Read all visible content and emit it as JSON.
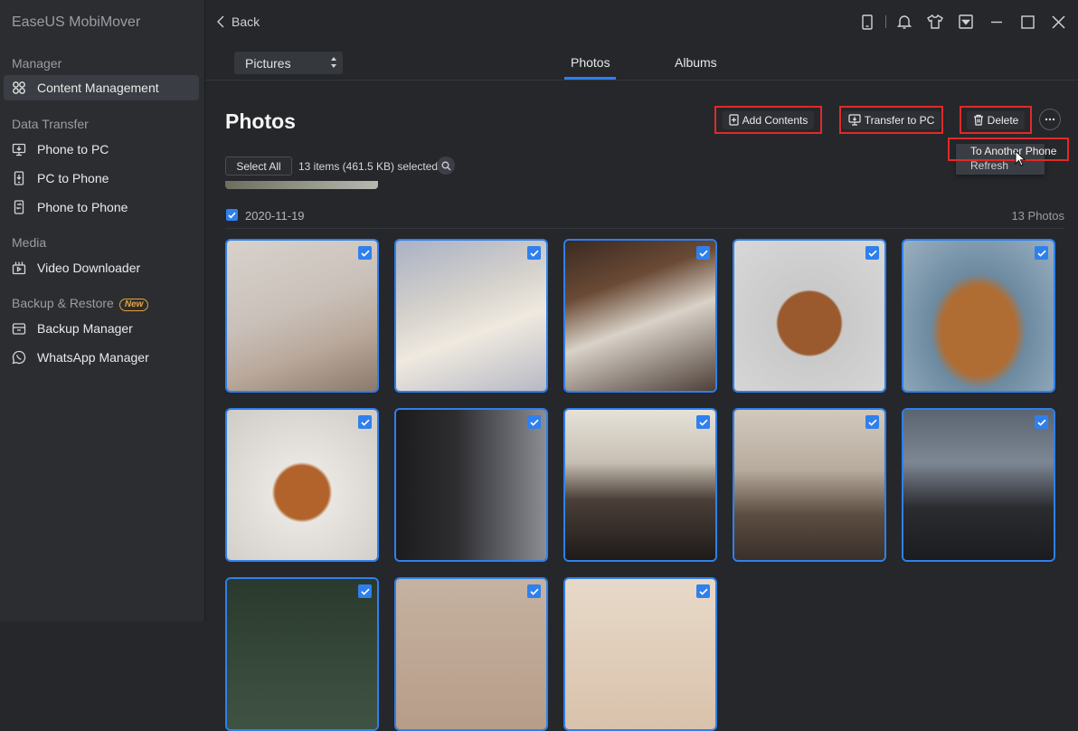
{
  "app": {
    "title": "EaseUS MobiMover"
  },
  "sidebar": {
    "sections": [
      {
        "label": "Manager"
      },
      {
        "label": "Data Transfer"
      },
      {
        "label": "Media"
      },
      {
        "label": "Backup & Restore",
        "badge": "New"
      }
    ],
    "items": [
      {
        "label": "Content Management",
        "icon": "content-icon",
        "active": true
      },
      {
        "label": "Phone to PC",
        "icon": "phone-to-pc-icon"
      },
      {
        "label": "PC to Phone",
        "icon": "pc-to-phone-icon"
      },
      {
        "label": "Phone to Phone",
        "icon": "phone-to-phone-icon"
      },
      {
        "label": "Video Downloader",
        "icon": "video-downloader-icon"
      },
      {
        "label": "Backup Manager",
        "icon": "backup-icon"
      },
      {
        "label": "WhatsApp Manager",
        "icon": "whatsapp-icon"
      }
    ]
  },
  "header": {
    "back_label": "Back",
    "window_icons": [
      "device-icon",
      "bell-icon",
      "shirt-icon",
      "dropdown-icon",
      "minimize-icon",
      "maximize-icon",
      "close-icon"
    ]
  },
  "toolbar": {
    "category": "Pictures",
    "tabs": [
      {
        "label": "Photos",
        "active": true
      },
      {
        "label": "Albums"
      }
    ],
    "page_title": "Photos",
    "actions": {
      "add_contents": "Add Contents",
      "transfer_to_pc": "Transfer to PC",
      "delete": "Delete"
    },
    "more_menu": {
      "items": [
        "To Another Phone",
        "Refresh"
      ]
    }
  },
  "selection": {
    "select_all": "Select All",
    "summary": "13 items (461.5 KB) selected"
  },
  "group": {
    "date": "2020-11-19",
    "count": "13 Photos",
    "checked": true
  },
  "colors": {
    "accent": "#2f80ed",
    "highlight": "#e02a2a",
    "badge": "#e8a23a"
  }
}
